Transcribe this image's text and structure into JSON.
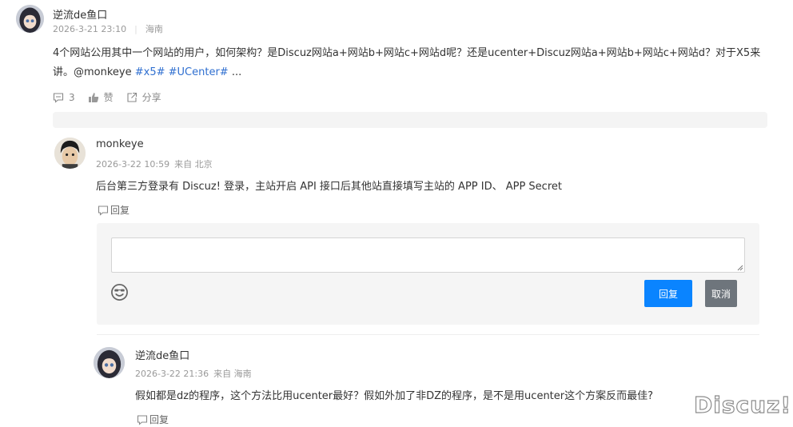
{
  "post": {
    "author": "逆流de鱼口",
    "date": "2026-3-21 23:10",
    "location": "海南",
    "content_text": "4个网站公用其中一个网站的用户，如何架构？是Discuz网站a+网站b+网站c+网站d呢？还是ucenter+Discuz网站a+网站b+网站c+网站d？对于X5来讲。@monkeye ",
    "tags": [
      "#x5#",
      "#UCenter#"
    ],
    "ellipsis": "...",
    "comment_count": "3",
    "like_label": "赞",
    "share_label": "分享"
  },
  "reply1": {
    "author": "monkeye",
    "date": "2026-3-22 10:59",
    "location": "来自 北京",
    "content": "后台第三方登录有 Discuz! 登录，主站开启 API 接口后其他站直接填写主站的  APP ID、 APP Secret",
    "reply_label": "回复"
  },
  "reply_form": {
    "input_value": "",
    "emoji_icon": "smiley-face-icon",
    "submit_label": "回复",
    "cancel_label": "取消",
    "primary_color": "#0a84ff",
    "secondary_color": "#6e757c"
  },
  "reply2": {
    "author": "逆流de鱼口",
    "date": "2026-3-22 21:36",
    "location": "来自 海南",
    "content": "假如都是dz的程序，这个方法比用ucenter最好？假如外加了非DZ的程序，是不是用ucenter这个方案反而最佳?",
    "reply_label": "回复"
  },
  "watermark": "Discuz!"
}
